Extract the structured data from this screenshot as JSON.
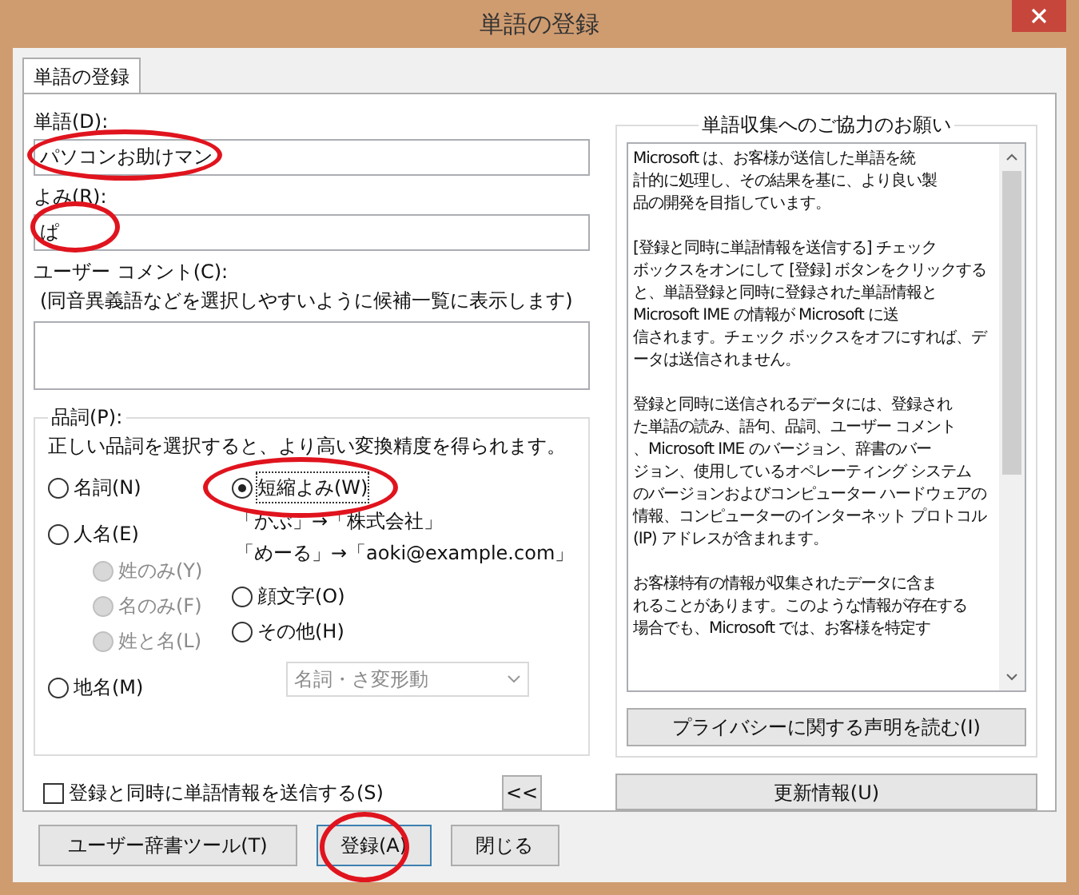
{
  "window": {
    "title": "単語の登録"
  },
  "tabs": [
    {
      "label": "単語の登録",
      "selected": true
    }
  ],
  "word": {
    "label": "単語(D):",
    "value": "パソコンお助けマン",
    "highlighted": true
  },
  "reading": {
    "label": "よみ(R):",
    "value": "ぱ",
    "highlighted": true
  },
  "comment": {
    "label": "ユーザー コメント(C):",
    "hint": "(同音異義語などを選択しやすいように候補一覧に表示します)"
  },
  "part_of_speech": {
    "label": "品詞(P):",
    "description": "正しい品詞を選択すると、より高い変換精度を得られます。",
    "left_options": [
      {
        "label": "名詞(N)",
        "selected": false,
        "disabled": false,
        "highlighted": false
      },
      {
        "label": "人名(E)",
        "selected": false,
        "disabled": false,
        "highlighted": false,
        "children": [
          {
            "label": "姓のみ(Y)",
            "selected": false,
            "disabled": true,
            "highlighted": false
          },
          {
            "label": "名のみ(F)",
            "selected": false,
            "disabled": true,
            "highlighted": false
          },
          {
            "label": "姓と名(L)",
            "selected": false,
            "disabled": true,
            "highlighted": false
          }
        ]
      },
      {
        "label": "地名(M)",
        "selected": false,
        "disabled": false,
        "highlighted": false
      }
    ],
    "right_options": [
      {
        "label": "短縮よみ(W)",
        "selected": true,
        "disabled": false,
        "highlighted": true,
        "examples": [
          "「かぶ」→「株式会社」",
          "「めーる」→「aoki@example.com」"
        ]
      },
      {
        "label": "顔文字(O)",
        "selected": false,
        "disabled": false,
        "highlighted": false
      },
      {
        "label": "その他(H)",
        "selected": false,
        "disabled": false,
        "highlighted": false
      }
    ],
    "dropdown": {
      "value": "名詞・さ変形動",
      "disabled": true
    }
  },
  "send_checkbox": {
    "label": "登録と同時に単語情報を送信する(S)",
    "checked": false
  },
  "collapse_button": "<<",
  "info_group": {
    "title": "単語収集へのご協力のお願い",
    "paragraphs": [
      [
        "Microsoft は、お客様が送信した単語を統",
        "計的に処理し、その結果を基に、より良い製",
        "品の開発を目指しています。"
      ],
      [
        "[登録と同時に単語情報を送信する] チェック",
        "ボックスをオンにして [登録] ボタンをクリックする",
        "と、単語登録と同時に登録された単語情報と",
        "Microsoft IME の情報が Microsoft に送",
        "信されます。チェック ボックスをオフにすれば、デ",
        "ータは送信されません。"
      ],
      [
        "登録と同時に送信されるデータには、登録され",
        "た単語の読み、語句、品詞、ユーザー コメント",
        "、Microsoft IME のバージョン、辞書のバー",
        "ジョン、使用しているオペレーティング システム",
        "のバージョンおよびコンピューター ハードウェアの",
        "情報、コンピューターのインターネット プロトコル",
        "(IP) アドレスが含まれます。"
      ],
      [
        "お客様特有の情報が収集されたデータに含ま",
        "れることがあります。このような情報が存在する",
        "場合でも、Microsoft では、お客様を特定す"
      ]
    ],
    "privacy_button": "プライバシーに関する声明を読む(I)"
  },
  "update_button": "更新情報(U)",
  "buttons": [
    {
      "label": "ユーザー辞書ツール(T)",
      "default": false,
      "highlighted": false
    },
    {
      "label": "登録(A)",
      "default": true,
      "highlighted": true
    },
    {
      "label": "閉じる",
      "default": false,
      "highlighted": false
    }
  ]
}
